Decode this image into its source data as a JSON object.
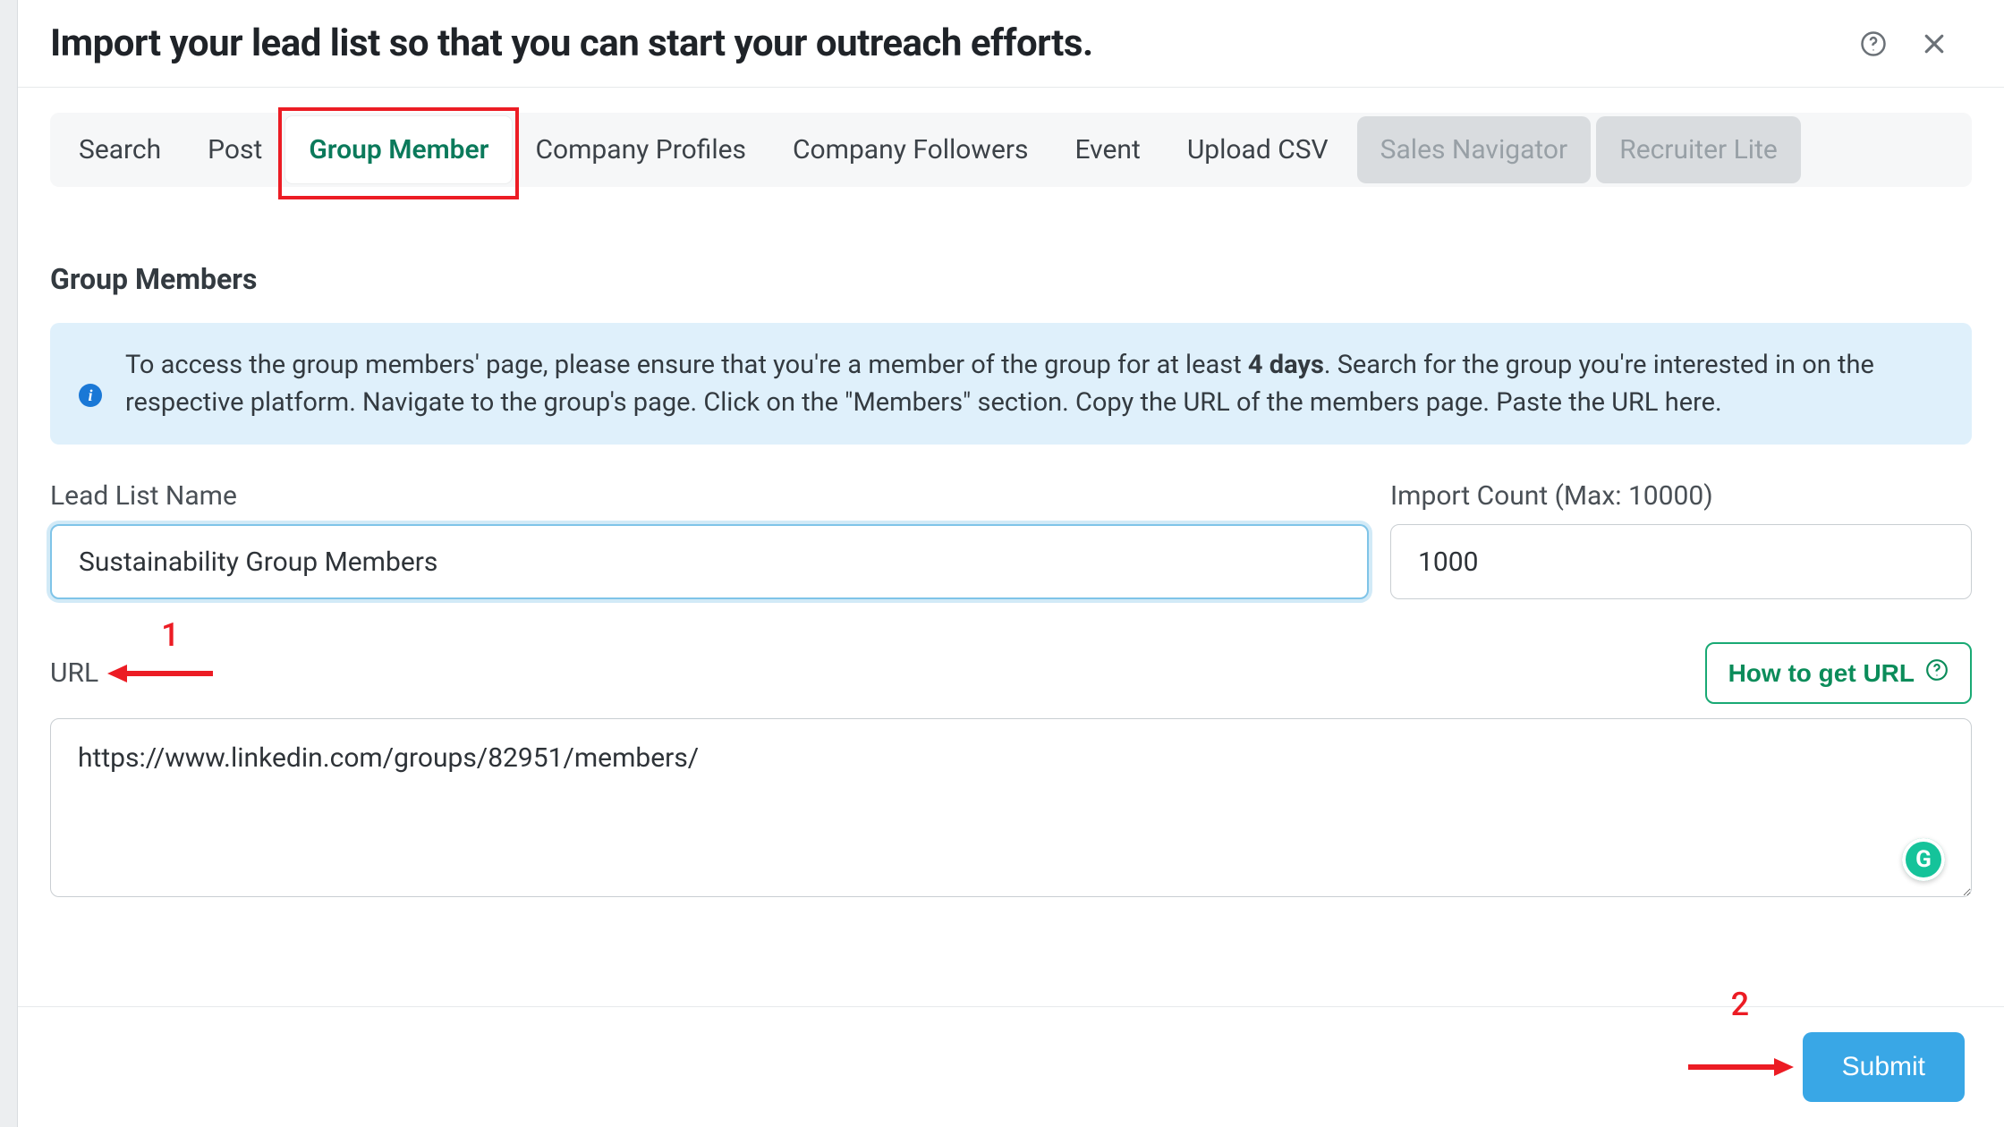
{
  "header": {
    "title": "Import your lead list so that you can start your outreach efforts."
  },
  "tabs": {
    "items": [
      {
        "label": "Search"
      },
      {
        "label": "Post"
      },
      {
        "label": "Group Member"
      },
      {
        "label": "Company Profiles"
      },
      {
        "label": "Company Followers"
      },
      {
        "label": "Event"
      },
      {
        "label": "Upload CSV"
      },
      {
        "label": "Sales Navigator"
      },
      {
        "label": "Recruiter Lite"
      }
    ],
    "active_index": 2
  },
  "section": {
    "title": "Group Members"
  },
  "info": {
    "text_before_bold": "To access the group members' page, please ensure that you're a member of the group for at least ",
    "bold": "4 days",
    "text_after_bold": ". Search for the group you're interested in on the respective platform. Navigate to the group's page. Click on the \"Members\" section. Copy the URL of the members page. Paste the URL here."
  },
  "form": {
    "lead_list_label": "Lead List Name",
    "lead_list_value": "Sustainability Group Members",
    "import_count_label": "Import Count (Max: 10000)",
    "import_count_value": "1000",
    "url_label": "URL",
    "howto_label": "How to get URL",
    "url_value": "https://www.linkedin.com/groups/82951/members/"
  },
  "footer": {
    "submit_label": "Submit"
  },
  "annotations": {
    "one": "1",
    "two": "2"
  },
  "grammarly": {
    "letter": "G"
  }
}
